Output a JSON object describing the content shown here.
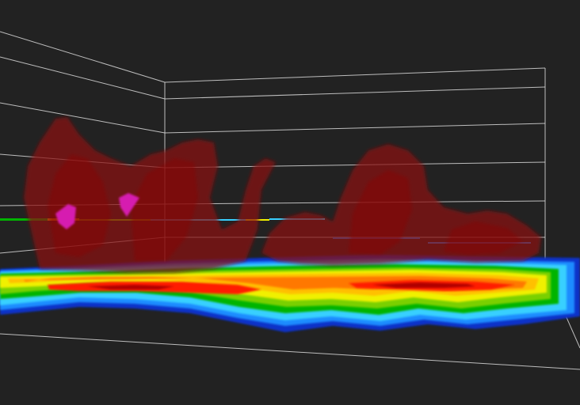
{
  "viewer": {
    "background_color": "#222222",
    "grid_line_color": "#d8d8d8",
    "isosurface_color": "#8b0a0a",
    "marker_color": "#d61fb0",
    "radar_colormap": [
      "#0a32c8",
      "#1e8cff",
      "#38d0ff",
      "#00b400",
      "#7ad000",
      "#f0f000",
      "#ffc000",
      "#ff7800",
      "#ff1e00",
      "#b00000"
    ]
  }
}
